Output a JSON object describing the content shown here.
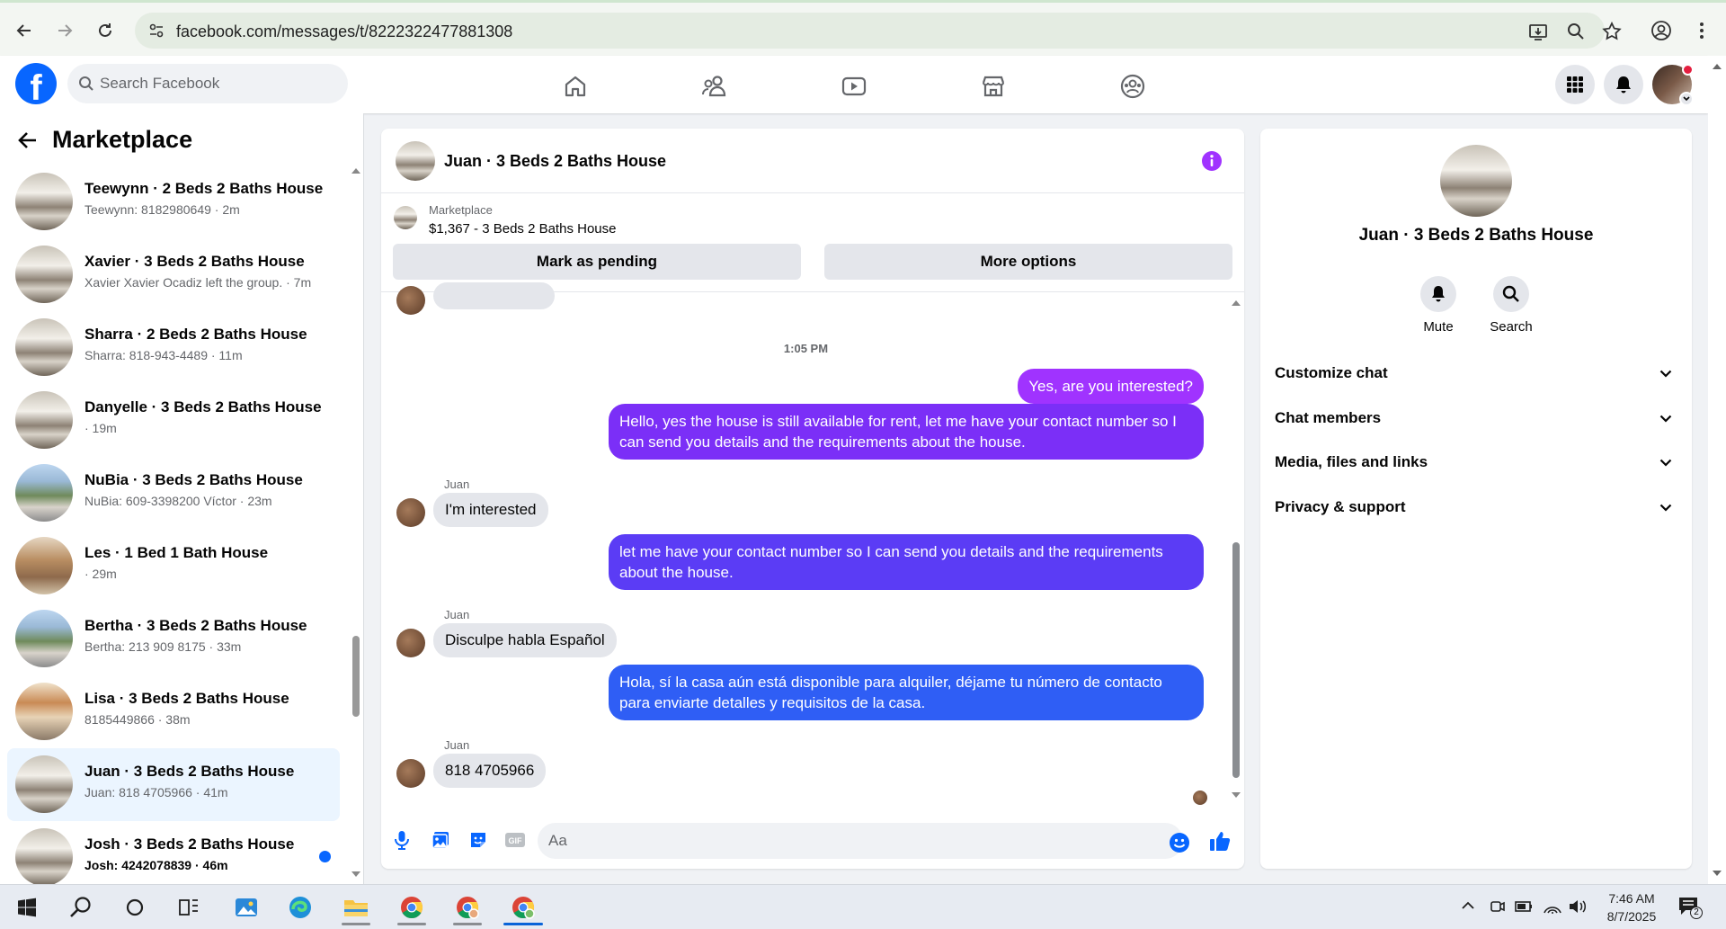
{
  "browser": {
    "url": "facebook.com/messages/t/8222322477881308"
  },
  "fb": {
    "logo": "f",
    "search_placeholder": "Search Facebook",
    "nav_icons": [
      "home-icon",
      "friends-icon",
      "watch-icon",
      "marketplace-icon",
      "groups-icon"
    ]
  },
  "left": {
    "title": "Marketplace",
    "conversations": [
      {
        "name": "Teewynn · 2 Beds 2 Baths House",
        "preview": "Teewynn: 8182980649 · 2m"
      },
      {
        "name": "Xavier · 3 Beds 2 Baths House",
        "preview": "Xavier Xavier Ocadiz left the group. · 7m"
      },
      {
        "name": "Sharra · 2 Beds 2 Baths House",
        "preview": "Sharra: 818-943-4489 · 11m"
      },
      {
        "name": "Danyelle · 3 Beds 2 Baths House",
        "preview": " · 19m"
      },
      {
        "name": "NuBia · 3 Beds 2 Baths House",
        "preview": "NuBia: 609-3398200 Víctor · 23m"
      },
      {
        "name": "Les · 1 Bed 1 Bath House",
        "preview": " · 29m"
      },
      {
        "name": "Bertha · 3 Beds 2 Baths House",
        "preview": "Bertha: 213 909 8175 · 33m"
      },
      {
        "name": "Lisa · 3 Beds 2 Baths House",
        "preview": "8185449866 · 38m"
      },
      {
        "name": "Juan · 3 Beds 2 Baths House",
        "preview": "Juan: 818 4705966 · 41m"
      },
      {
        "name": "Josh · 3 Beds 2 Baths House",
        "preview": "Josh: 4242078839 · 46m"
      }
    ]
  },
  "chat": {
    "title": "Juan · 3 Beds 2 Baths House",
    "marketplace_label": "Marketplace",
    "listing": "$1,367 - 3 Beds 2 Baths House",
    "btn_pending": "Mark as pending",
    "btn_more": "More options",
    "time": "1:05 PM",
    "out1": "Yes, are you interested?",
    "out2": "Hello, yes the house is still available for rent, let me have your contact number so I can send you details and the requirements about the house.",
    "sender": "Juan",
    "in1": "I'm interested",
    "out3": "let me have your contact number so I can send you details and the requirements about the house.",
    "in2": "Disculpe habla Español",
    "out4": "Hola, sí la casa aún está disponible para alquiler, déjame tu número de contacto para enviarte detalles y requisitos de la casa.",
    "in3": "818 4705966",
    "composer_placeholder": "Aa",
    "colors": {
      "purple": "#a033ff",
      "violet": "#7b2ff7",
      "indigo": "#5b3cf5",
      "blue": "#2f5ef5"
    }
  },
  "right": {
    "name": "Juan · 3 Beds 2 Baths House",
    "mute": "Mute",
    "search": "Search",
    "sections": [
      "Customize chat",
      "Chat members",
      "Media, files and links",
      "Privacy & support"
    ]
  },
  "taskbar": {
    "time": "7:46 AM",
    "date": "8/7/2025",
    "notif_count": "2"
  }
}
